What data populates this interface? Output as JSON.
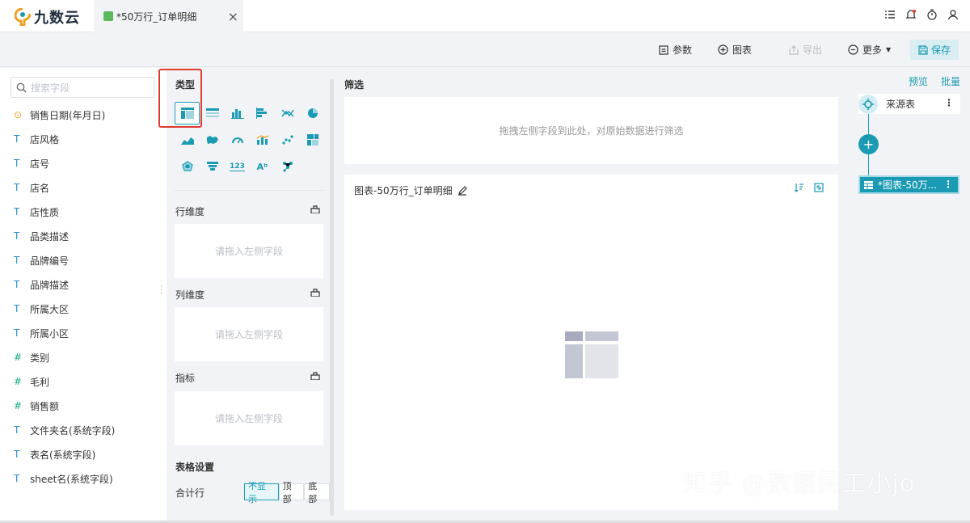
{
  "app": {
    "logo_text": "九数云"
  },
  "tab": {
    "title": "*50万行_订单明细",
    "close": "×"
  },
  "toolbar": {
    "params": "参数",
    "chart": "图表",
    "export": "导出",
    "more": "更多",
    "save": "保存"
  },
  "search": {
    "placeholder": "搜索字段"
  },
  "fields": [
    {
      "type": "⊙",
      "kind": "date",
      "label": "销售日期(年月日)"
    },
    {
      "type": "T",
      "kind": "text",
      "label": "店风格"
    },
    {
      "type": "T",
      "kind": "text",
      "label": "店号"
    },
    {
      "type": "T",
      "kind": "text",
      "label": "店名"
    },
    {
      "type": "T",
      "kind": "text",
      "label": "店性质"
    },
    {
      "type": "T",
      "kind": "text",
      "label": "品类描述"
    },
    {
      "type": "T",
      "kind": "text",
      "label": "品牌编号"
    },
    {
      "type": "T",
      "kind": "text",
      "label": "品牌描述"
    },
    {
      "type": "T",
      "kind": "text",
      "label": "所属大区"
    },
    {
      "type": "T",
      "kind": "text",
      "label": "所属小区"
    },
    {
      "type": "#",
      "kind": "num",
      "label": "类别"
    },
    {
      "type": "#",
      "kind": "num",
      "label": "毛利"
    },
    {
      "type": "#",
      "kind": "num",
      "label": "销售额"
    },
    {
      "type": "T",
      "kind": "text",
      "label": "文件夹名(系统字段)"
    },
    {
      "type": "T",
      "kind": "text",
      "label": "表名(系统字段)"
    },
    {
      "type": "T",
      "kind": "text",
      "label": "sheet名(系统字段)"
    }
  ],
  "config": {
    "type_title": "类型",
    "row_dim": "行维度",
    "col_dim": "列维度",
    "metric": "指标",
    "drop_hint": "请拖入左侧字段",
    "table_settings": "表格设置",
    "total_row": "合计行",
    "total_options": [
      "不显示",
      "顶部",
      "底部"
    ]
  },
  "filter": {
    "title": "筛选",
    "hint": "拖拽左侧字段到此处，对原始数据进行筛选"
  },
  "chart": {
    "title": "图表-50万行_订单明细"
  },
  "right": {
    "preview": "预览",
    "batch": "批量",
    "source": "来源表",
    "node_label": "*图表-50万..."
  },
  "watermark": "知乎 @数据民工小jo",
  "colors": {
    "accent": "#1a9bb3",
    "highlight": "#e03a2f"
  }
}
